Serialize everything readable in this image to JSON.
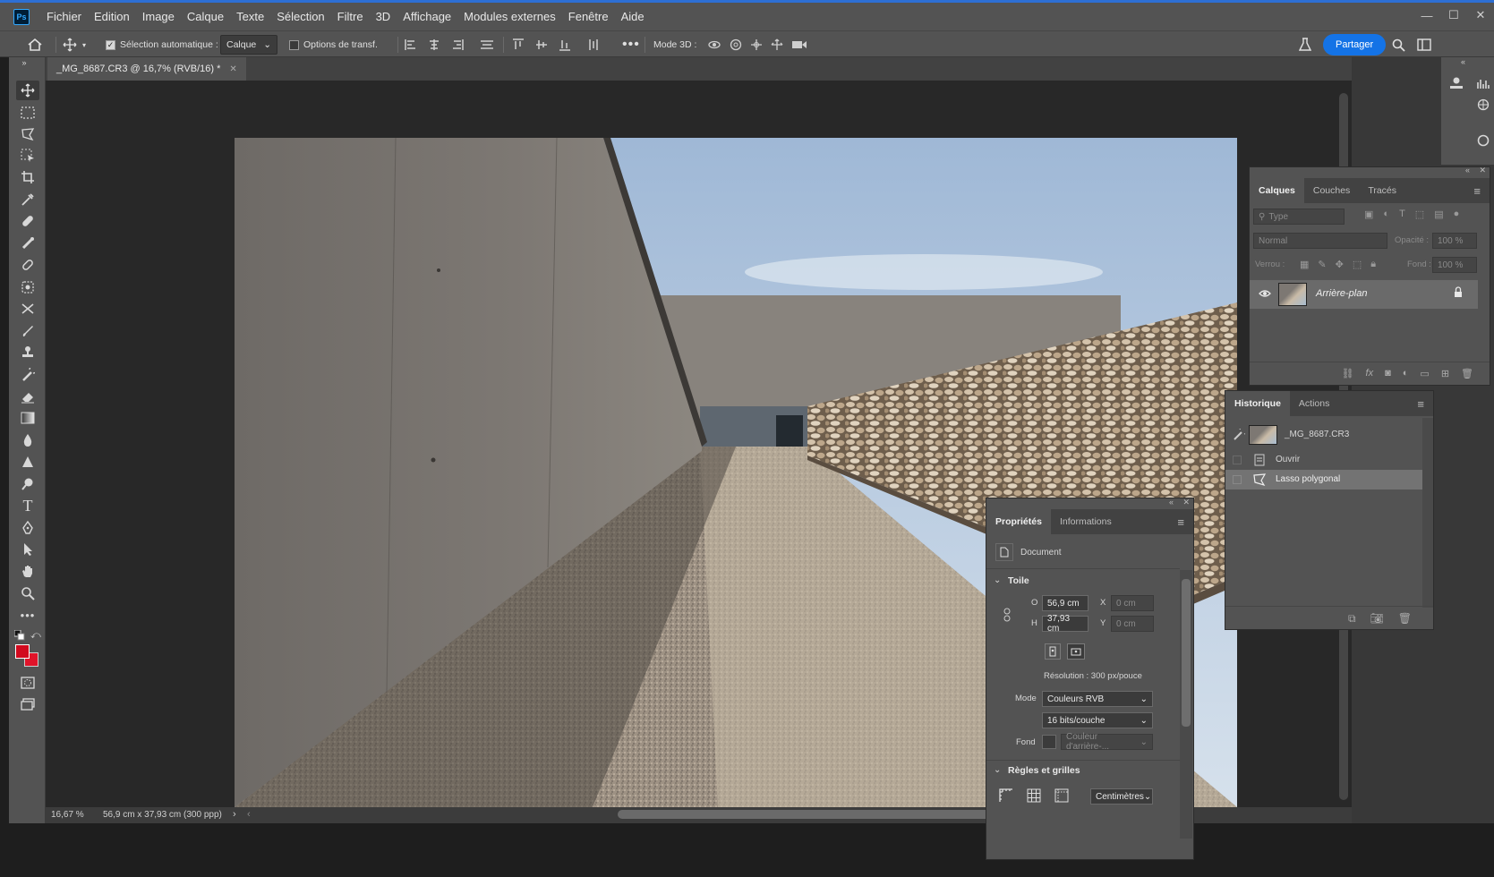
{
  "app": {
    "logo": "Ps"
  },
  "menu": [
    "Fichier",
    "Edition",
    "Image",
    "Calque",
    "Texte",
    "Sélection",
    "Filtre",
    "3D",
    "Affichage",
    "Modules externes",
    "Fenêtre",
    "Aide"
  ],
  "window_controls": {
    "minimize": "—",
    "maximize": "☐",
    "close": "✕"
  },
  "options": {
    "auto_select_label": "Sélection automatique :",
    "auto_select_checked": true,
    "target": "Calque",
    "transform_label": "Options de transf.",
    "mode3d_label": "Mode 3D :",
    "share": "Partager"
  },
  "document": {
    "tab_title": "_MG_8687.CR3 @ 16,7% (RVB/16) *",
    "zoom": "16,67 %",
    "size_info": "56,9 cm x 37,93 cm (300 ppp)"
  },
  "layers_panel": {
    "tabs": [
      "Calques",
      "Couches",
      "Tracés"
    ],
    "search_placeholder": "Type",
    "blend_mode": "Normal",
    "opacity_label": "Opacité :",
    "opacity": "100 %",
    "lock_label": "Verrou :",
    "fill_label": "Fond :",
    "fill": "100 %",
    "layer_name": "Arrière-plan"
  },
  "history_panel": {
    "tabs": [
      "Historique",
      "Actions"
    ],
    "snapshot": "_MG_8687.CR3",
    "steps": [
      "Ouvrir",
      "Lasso polygonal"
    ]
  },
  "properties_panel": {
    "tabs": [
      "Propriétés",
      "Informations"
    ],
    "type_label": "Document",
    "canvas_section": "Toile",
    "w_label": "O",
    "w_value": "56,9 cm",
    "h_label": "H",
    "h_value": "37,93 cm",
    "x_label": "X",
    "x_value": "0 cm",
    "y_label": "Y",
    "y_value": "0 cm",
    "resolution": "Résolution : 300 px/pouce",
    "mode_label": "Mode",
    "mode_value": "Couleurs RVB",
    "depth_value": "16 bits/couche",
    "fill_label": "Fond",
    "fill_value": "Couleur d'arrière-...",
    "rulers_section": "Règles et grilles",
    "units": "Centimètres"
  },
  "colors": {
    "accent": "#1473e6",
    "foreground_swatch": "#d10a1e",
    "background_swatch": "#e0142a"
  }
}
